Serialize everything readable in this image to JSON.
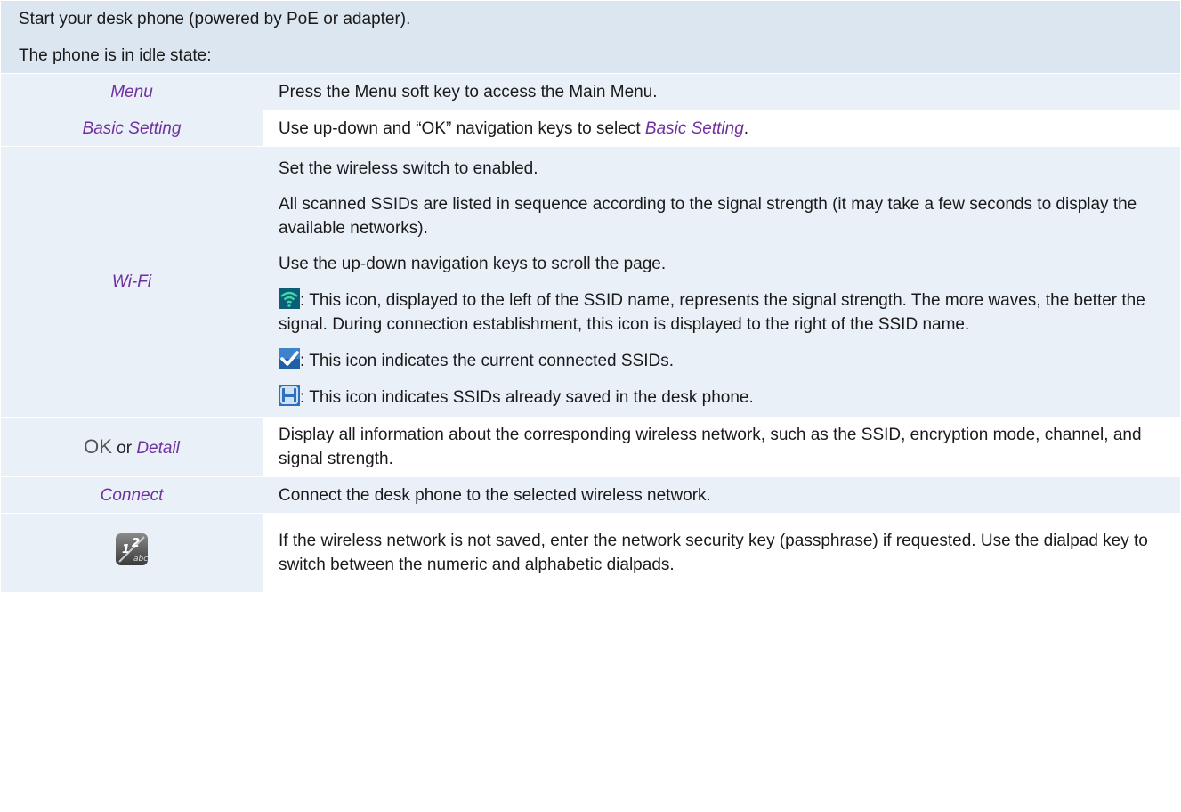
{
  "header_rows": [
    "Start your desk phone (powered by PoE or adapter).",
    "The phone is in idle state:"
  ],
  "rows": {
    "menu": {
      "label": "Menu",
      "text": "Press the Menu soft key to access the Main Menu."
    },
    "basic_setting": {
      "label": "Basic Setting",
      "text_before": "Use up-down and “OK” navigation keys to select ",
      "text_link": "Basic Setting",
      "text_after": "."
    },
    "wifi": {
      "label": "Wi-Fi",
      "p1": "Set the wireless switch to enabled.",
      "p2": "All scanned SSIDs are listed in sequence according to the signal strength (it may take a few seconds to display the available networks).",
      "p3": "Use the up-down navigation keys to scroll the page.",
      "signal_icon": "wifi-signal-icon",
      "p4": ": This icon, displayed to the left of the SSID name, represents the signal strength. The more waves, the better the signal. During connection establishment, this icon is displayed to the right of the SSID name.",
      "connected_icon": "checkmark-icon",
      "p5": ": This icon indicates the current connected SSIDs.",
      "saved_icon": "saved-disk-icon",
      "p6": ": This icon indicates SSIDs already saved in the desk phone."
    },
    "detail": {
      "label_key": "OK",
      "label_or": " or ",
      "label_soft": "Detail",
      "text": "Display all information about the corresponding wireless network, such as the SSID, encryption mode, channel, and signal strength."
    },
    "connect": {
      "label": "Connect",
      "text": "Connect the desk phone to the selected wireless network."
    },
    "dialpad": {
      "icon": "dialpad-switch-icon",
      "text": "If the wireless network is not saved, enter the network security key (passphrase) if requested. Use the dialpad key to switch between the numeric and alphabetic dialpads."
    }
  },
  "colors": {
    "header_bg": "#dce6f1",
    "cell_bg": "#eaf0f8",
    "label_purple": "#7030a0"
  }
}
